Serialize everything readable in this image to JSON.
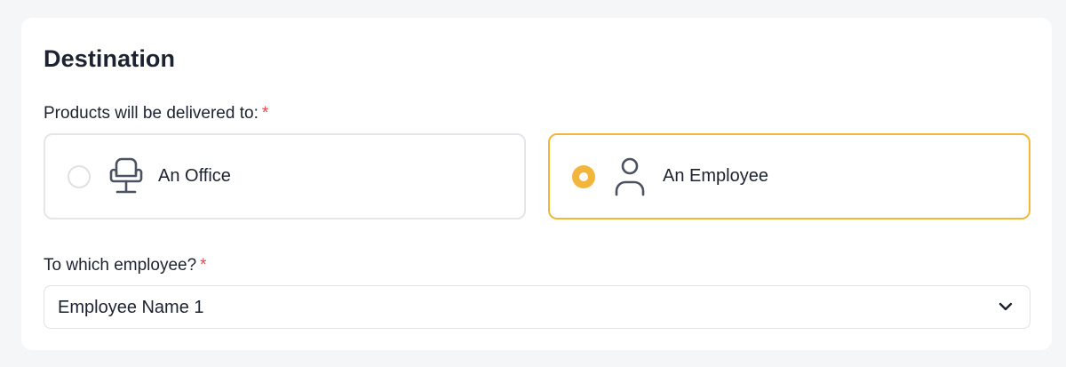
{
  "destination": {
    "title": "Destination",
    "delivery_label": "Products will be delivered to:",
    "required_mark": "*",
    "options": [
      {
        "label": "An Office",
        "icon": "office-chair-icon",
        "selected": false
      },
      {
        "label": "An Employee",
        "icon": "person-icon",
        "selected": true
      }
    ],
    "employee_label": "To which employee?",
    "employee_select": {
      "value": "Employee Name 1",
      "icon": "chevron-down-icon"
    }
  },
  "colors": {
    "accent": "#f2b63d",
    "required": "#e5484d",
    "text": "#1c2230",
    "border": "#e4e6ea",
    "page_background": "#f5f6f8"
  }
}
